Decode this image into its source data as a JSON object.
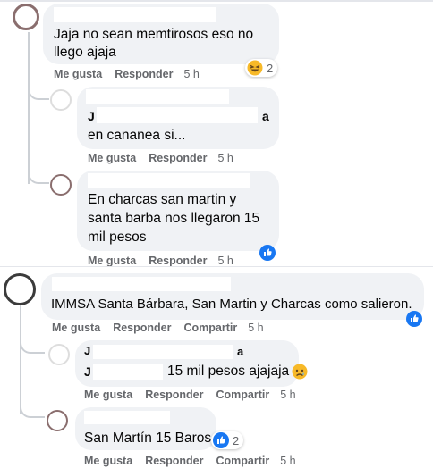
{
  "colors": {
    "bubble": "#f0f2f5",
    "meta": "#65676b",
    "like_blue": "#1877f2",
    "haha_yellow": "#f7b928"
  },
  "comments": [
    {
      "text_lines": [
        "Jaja no sean memtirosos eso no",
        "llego ajaja"
      ],
      "actions": [
        "Me gusta",
        "Responder"
      ],
      "time": "5 h",
      "reaction_count": "2",
      "reaction_icon": "haha-emoji-icon"
    },
    {
      "prefix": "J",
      "suffix": "a",
      "text_lines": [
        "en cananea si..."
      ],
      "actions": [
        "Me gusta",
        "Responder"
      ],
      "time": "5 h"
    },
    {
      "text_lines": [
        "En charcas san martin y",
        "santa barba nos llegaron 15",
        "mil pesos"
      ],
      "actions": [
        "Me gusta",
        "Responder"
      ],
      "time": "5 h",
      "reaction_icon": "like-icon"
    },
    {
      "text_lines": [
        "IMMSA Santa Bárbara, San Martin y Charcas como salieron."
      ],
      "actions": [
        "Me gusta",
        "Responder",
        "Compartir"
      ],
      "time": "5 h",
      "reaction_icon": "like-icon"
    },
    {
      "prefix": "J",
      "suffix": "a",
      "line2_prefix": "J",
      "text_lines": [
        "15 mil pesos ajajaja"
      ],
      "actions": [
        "Me gusta",
        "Responder",
        "Compartir"
      ],
      "time": "5 h",
      "reaction_icon": "sad-emoji-icon"
    },
    {
      "text_lines": [
        "San Martín 15 Baros"
      ],
      "actions": [
        "Me gusta",
        "Responder",
        "Compartir"
      ],
      "time": "5 h",
      "reaction_count": "2",
      "reaction_icon": "like-icon"
    }
  ]
}
